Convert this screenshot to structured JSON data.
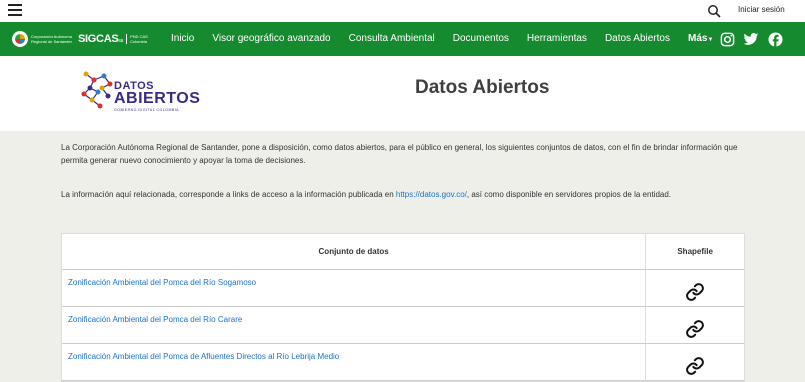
{
  "topbar": {
    "login_label": "Iniciar sesión"
  },
  "brand": {
    "corp_text": "Corporación Autónoma Regional de Santander",
    "sig_text": "SIGCAS",
    "sig_suffix": "sa",
    "gov_text": "PND CAS Colombia"
  },
  "nav": {
    "items": [
      "Inicio",
      "Visor geográfico avanzado",
      "Consulta Ambiental",
      "Documentos",
      "Herramientas",
      "Datos Abiertos"
    ],
    "more_label": "Más"
  },
  "header": {
    "logo_line1": "DATOS",
    "logo_line2": "ABIERTOS",
    "logo_line3": "GOBIERNO DIGITAL COLOMBIA",
    "title": "Datos Abiertos"
  },
  "intro": {
    "p1": "La Corporación Autónoma Regional de Santander, pone a disposición, como datos abiertos, para el público en general, los siguientes conjuntos de datos, con el fin de brindar información que permita generar nuevo conocimiento y apoyar la toma de decisiones.",
    "p2_before": "La información aquí relacionada, corresponde a links de acceso a la información publicada en ",
    "p2_link": "https://datos.gov.co/",
    "p2_after": ", así como disponible en servidores propios de la entidad."
  },
  "table": {
    "headers": [
      "Conjunto de datos",
      "Shapefile"
    ],
    "rows": [
      "Zonificación Ambiental del Pomca del Río Sogamoso",
      "Zonificación Ambiental del Pomca del Río Carare",
      "Zonificación Ambiental del Pomca de Afluentes Directos al Río Lebrija Medio"
    ]
  },
  "icons": {
    "search": "search-icon",
    "link": "link-icon",
    "instagram": "instagram-icon",
    "twitter": "twitter-icon",
    "facebook": "facebook-icon"
  },
  "colors": {
    "nav_green": "#158a2e",
    "link_blue": "#1a73c9",
    "brand_purple": "#3b2a86"
  }
}
